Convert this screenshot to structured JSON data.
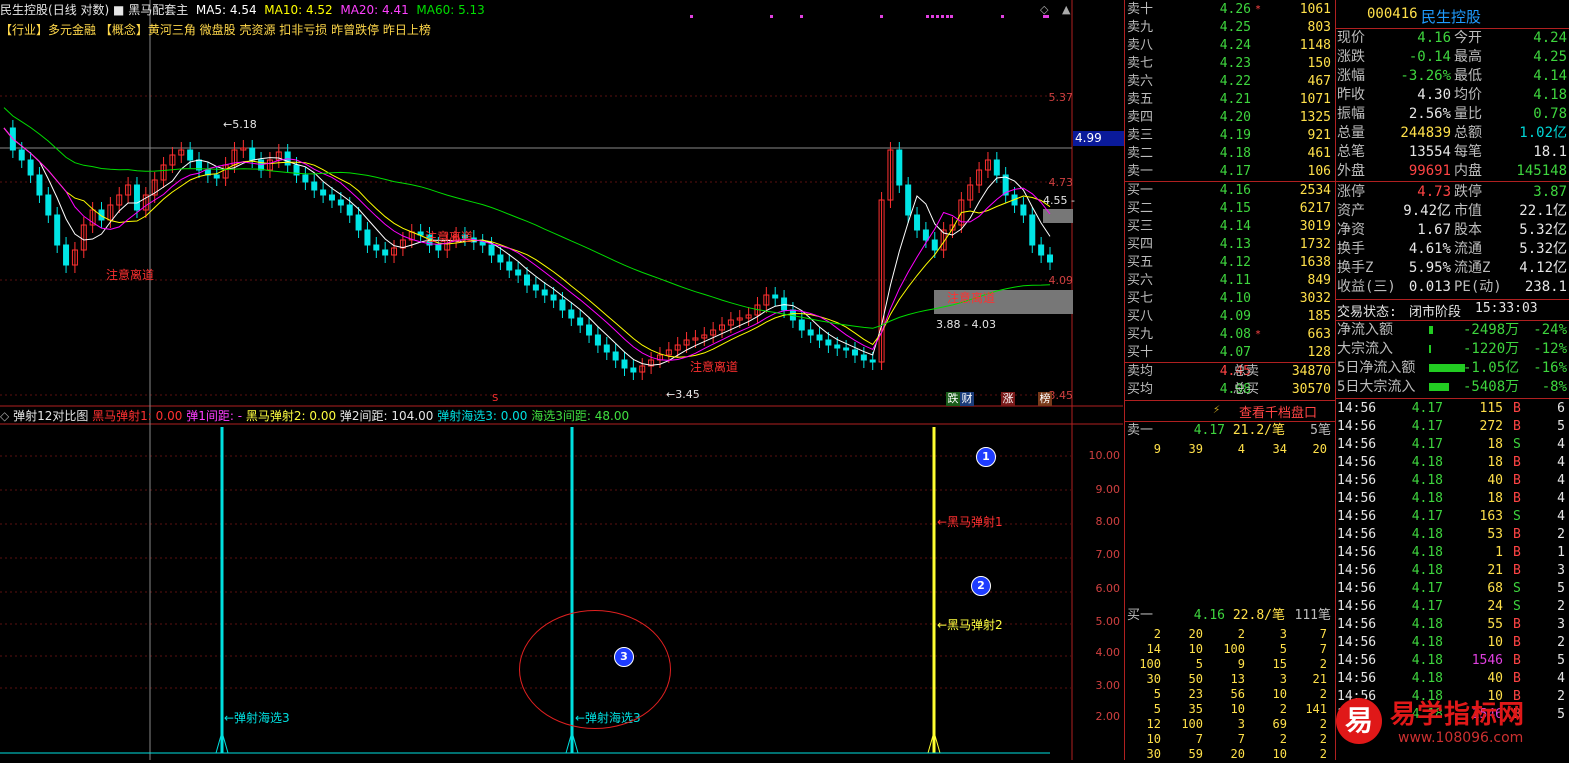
{
  "title": {
    "stock_name": "民生控股",
    "mode": "(日线 对数)",
    "indicator_name": "黑马配套主",
    "ma5": "MA5: 4.54",
    "ma10": "MA10: 4.52",
    "ma20": "MA20: 4.41",
    "ma60": "MA60: 5.13"
  },
  "tags": "【行业】多元金融 【概念】黄河三角 微盘股 壳资源 扣非亏损 昨曾跌停 昨日上榜",
  "main_chart": {
    "y_ticks": [
      "5.37",
      "4.73",
      "4.09",
      "3.45"
    ],
    "crosshair_price": "4.99",
    "high_label": "5.18",
    "low_label": "3.45",
    "range_label": "3.88 - 4.03",
    "last_label": "4.55 -",
    "warning_labels": [
      "注意离道",
      "注意离道",
      "注意离道",
      "注意离道"
    ],
    "marker_s": "S",
    "badges": [
      "跌",
      "财",
      "涨",
      "榜"
    ],
    "colors": {
      "ma5": "#ffffff",
      "ma10": "#ffff00",
      "ma20": "#ff00ff",
      "ma60": "#00dd00",
      "up": "#ff3030",
      "down": "#00e5e5"
    }
  },
  "sub_chart": {
    "name": "弹射12对比图",
    "legend": [
      {
        "text": "黑马弹射1: 0.00",
        "color": "#ff3030"
      },
      {
        "text": "弹1间距: -",
        "color": "#ff40ff"
      },
      {
        "text": "黑马弹射2: 0.00",
        "color": "#ffff40"
      },
      {
        "text": "弹2间距: 104.00",
        "color": "#e6e6e6"
      },
      {
        "text": "弹射海选3: 0.00",
        "color": "#00e0e0"
      },
      {
        "text": "海选3间距: 48.00",
        "color": "#40e040"
      }
    ],
    "y_ticks": [
      "10.00",
      "9.00",
      "8.00",
      "7.00",
      "6.00",
      "5.00",
      "4.00",
      "3.00",
      "2.00"
    ],
    "annotations": [
      "←黑马弹射1",
      "←黑马弹射2",
      "←弹射海选3",
      "←弹射海选3"
    ],
    "circle_numbers": [
      "1",
      "2",
      "3"
    ]
  },
  "order_book": {
    "sells": [
      {
        "label": "卖十",
        "price": "4.26",
        "flag": "*",
        "vol": "1061"
      },
      {
        "label": "卖九",
        "price": "4.25",
        "flag": "",
        "vol": "803"
      },
      {
        "label": "卖八",
        "price": "4.24",
        "flag": "",
        "vol": "1148"
      },
      {
        "label": "卖七",
        "price": "4.23",
        "flag": "",
        "vol": "150"
      },
      {
        "label": "卖六",
        "price": "4.22",
        "flag": "",
        "vol": "467"
      },
      {
        "label": "卖五",
        "price": "4.21",
        "flag": "",
        "vol": "1071"
      },
      {
        "label": "卖四",
        "price": "4.20",
        "flag": "",
        "vol": "1325"
      },
      {
        "label": "卖三",
        "price": "4.19",
        "flag": "",
        "vol": "921"
      },
      {
        "label": "卖二",
        "price": "4.18",
        "flag": "",
        "vol": "461"
      },
      {
        "label": "卖一",
        "price": "4.17",
        "flag": "",
        "vol": "106"
      }
    ],
    "buys": [
      {
        "label": "买一",
        "price": "4.16",
        "flag": "",
        "vol": "2534"
      },
      {
        "label": "买二",
        "price": "4.15",
        "flag": "",
        "vol": "6217"
      },
      {
        "label": "买三",
        "price": "4.14",
        "flag": "",
        "vol": "3019"
      },
      {
        "label": "买四",
        "price": "4.13",
        "flag": "",
        "vol": "1732"
      },
      {
        "label": "买五",
        "price": "4.12",
        "flag": "",
        "vol": "1638"
      },
      {
        "label": "买六",
        "price": "4.11",
        "flag": "",
        "vol": "849"
      },
      {
        "label": "买七",
        "price": "4.10",
        "flag": "",
        "vol": "3032"
      },
      {
        "label": "买八",
        "price": "4.09",
        "flag": "",
        "vol": "185"
      },
      {
        "label": "买九",
        "price": "4.08",
        "flag": "*",
        "vol": "663"
      },
      {
        "label": "买十",
        "price": "4.07",
        "flag": "",
        "vol": "128"
      }
    ],
    "summary": [
      {
        "label": "卖均",
        "price": "4.45",
        "label2": "总卖",
        "vol": "34870"
      },
      {
        "label": "买均",
        "price": "4.08",
        "label2": "总买",
        "vol": "30570"
      }
    ],
    "thousand_link": "查看千档盘口",
    "sell1_header": {
      "label": "卖一",
      "price": "4.17",
      "avg": "21.2/笔",
      "count": "5笔"
    },
    "sell1_detail": [
      [
        "9",
        "39",
        "4",
        "34",
        "20"
      ]
    ],
    "buy1_header": {
      "label": "买一",
      "price": "4.16",
      "avg": "22.8/笔",
      "count": "111笔"
    },
    "buy1_detail": [
      [
        "2",
        "20",
        "2",
        "3",
        "7"
      ],
      [
        "14",
        "10",
        "100",
        "5",
        "7"
      ],
      [
        "100",
        "5",
        "9",
        "15",
        "2"
      ],
      [
        "30",
        "50",
        "13",
        "3",
        "21"
      ],
      [
        "5",
        "23",
        "56",
        "10",
        "2"
      ],
      [
        "5",
        "35",
        "10",
        "2",
        "141"
      ],
      [
        "12",
        "100",
        "3",
        "69",
        "2"
      ],
      [
        "10",
        "7",
        "7",
        "2",
        "2"
      ],
      [
        "30",
        "59",
        "20",
        "10",
        "2"
      ]
    ]
  },
  "quote": {
    "code": "000416",
    "name": "民生控股",
    "rows": [
      [
        "现价",
        "4.16",
        "今开",
        "4.24"
      ],
      [
        "涨跌",
        "-0.14",
        "最高",
        "4.25"
      ],
      [
        "涨幅",
        "-3.26%",
        "最低",
        "4.14"
      ],
      [
        "昨收",
        "4.30",
        "均价",
        "4.18"
      ],
      [
        "振幅",
        "2.56%",
        "量比",
        "0.78"
      ],
      [
        "总量",
        "244839",
        "总额",
        "1.02亿"
      ],
      [
        "总笔",
        "13554",
        "每笔",
        "18.1"
      ],
      [
        "外盘",
        "99691",
        "内盘",
        "145148"
      ],
      [
        "涨停",
        "4.73",
        "跌停",
        "3.87"
      ],
      [
        "资产",
        "9.42亿",
        "市值",
        "22.1亿"
      ],
      [
        "净资",
        "1.67",
        "股本",
        "5.32亿"
      ],
      [
        "换手",
        "4.61%",
        "流通",
        "5.32亿"
      ],
      [
        "换手Z",
        "5.95%",
        "流通Z",
        "4.12亿"
      ],
      [
        "收益(三)",
        "0.013",
        "PE(动)",
        "238.1"
      ]
    ],
    "status_label": "交易状态:",
    "status": "闭市阶段",
    "status_time": "15:33:03",
    "flows": [
      {
        "label": "净流入额",
        "value": "-2498万",
        "pct": "-24%",
        "bar": 0.1
      },
      {
        "label": "大宗流入",
        "value": "-1220万",
        "pct": "-12%",
        "bar": 0.05
      },
      {
        "label": "5日净流入额",
        "value": "-1.05亿",
        "pct": "-16%",
        "bar": 0.9
      },
      {
        "label": "5日大宗流入",
        "value": "-5408万",
        "pct": "-8%",
        "bar": 0.5
      }
    ]
  },
  "ticks": [
    [
      "14:56",
      "4.17",
      "115",
      "B",
      "6"
    ],
    [
      "14:56",
      "4.17",
      "272",
      "B",
      "5"
    ],
    [
      "14:56",
      "4.17",
      "18",
      "S",
      "4"
    ],
    [
      "14:56",
      "4.18",
      "18",
      "B",
      "4"
    ],
    [
      "14:56",
      "4.18",
      "40",
      "B",
      "4"
    ],
    [
      "14:56",
      "4.18",
      "18",
      "B",
      "4"
    ],
    [
      "14:56",
      "4.17",
      "163",
      "S",
      "4"
    ],
    [
      "14:56",
      "4.18",
      "53",
      "B",
      "2"
    ],
    [
      "14:56",
      "4.18",
      "1",
      "B",
      "1"
    ],
    [
      "14:56",
      "4.18",
      "21",
      "B",
      "3"
    ],
    [
      "14:56",
      "4.17",
      "68",
      "S",
      "5"
    ],
    [
      "14:56",
      "4.17",
      "24",
      "S",
      "2"
    ],
    [
      "14:56",
      "4.18",
      "55",
      "B",
      "3"
    ],
    [
      "14:56",
      "4.18",
      "10",
      "B",
      "2"
    ],
    [
      "14:56",
      "4.18",
      "1546",
      "B",
      "5"
    ],
    [
      "14:56",
      "4.18",
      "40",
      "B",
      "4"
    ],
    [
      "14:56",
      "4.18",
      "10",
      "B",
      "2"
    ],
    [
      "14:56",
      "4.18",
      "1546",
      "B",
      "5"
    ]
  ],
  "watermark": {
    "logo": "易",
    "text": "易学指标网",
    "url": "www.108096.com"
  }
}
